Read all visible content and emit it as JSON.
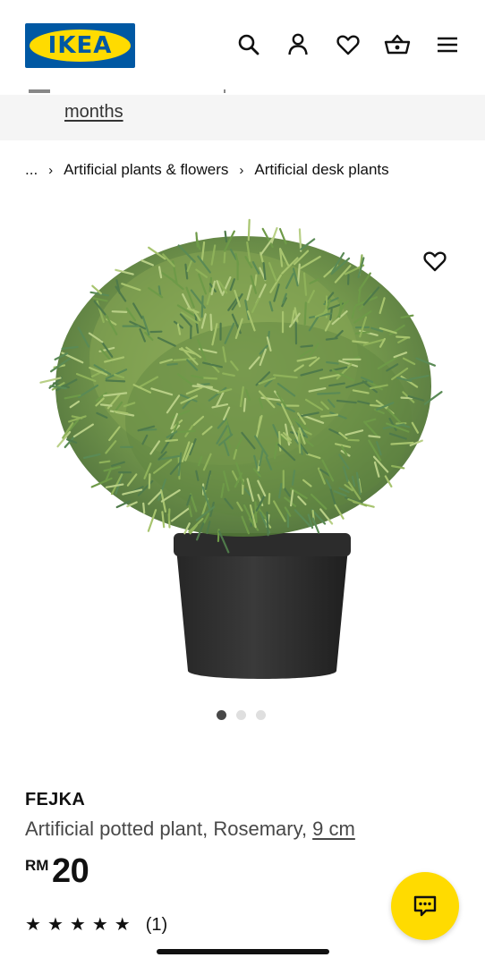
{
  "header": {
    "logo_text": "IKEA",
    "icons": [
      "search-icon",
      "account-icon",
      "heart-icon",
      "basket-icon",
      "menu-icon"
    ]
  },
  "banner": {
    "link_text": "months"
  },
  "breadcrumb": {
    "ellipsis": "...",
    "separator": "›",
    "items": [
      "Artificial plants & flowers",
      "Artificial desk plants"
    ]
  },
  "gallery": {
    "image_count": 3,
    "active_index": 0
  },
  "product": {
    "name": "FEJKA",
    "description": "Artificial potted plant, Rosemary, ",
    "size": "9 cm",
    "currency": "RM",
    "price": "20",
    "rating_stars": 5,
    "review_count": "(1)"
  },
  "colors": {
    "brand_blue": "#0058a3",
    "brand_yellow": "#ffdb00",
    "banner_bg": "#f5f5f5"
  }
}
